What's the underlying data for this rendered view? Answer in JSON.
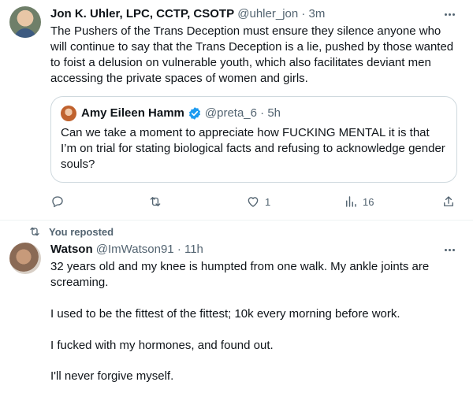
{
  "tweet1": {
    "author_name": "Jon K. Uhler, LPC, CCTP, CSOTP",
    "handle_time": "@uhler_jon · 3m",
    "text": "The Pushers of the Trans Deception must ensure they silence anyone who will continue to say that the Trans Deception is a lie, pushed by those wanted to foist a delusion on vulnerable youth, which also facilitates deviant men accessing the private spaces of women and girls.",
    "quote": {
      "author_name": "Amy Eileen Hamm",
      "handle_time": "@preta_6 · 5h",
      "text": "Can we take a moment to appreciate how FUCKING MENTAL it is that I’m on trial for stating biological facts and refusing to acknowledge gender souls?"
    },
    "actions": {
      "reply_count": "",
      "repost_count": "",
      "like_count": "1",
      "views_count": "16"
    }
  },
  "tweet2": {
    "repost_label": "You reposted",
    "author_name": "Watson",
    "handle_time": "@ImWatson91 · 11h",
    "paragraphs": [
      "32 years old and my knee is humpted from one walk. My ankle joints are screaming.",
      "I used to be the fittest of the fittest; 10k every morning before work.",
      "I fucked with my hormones, and found out.",
      "I'll never forgive myself."
    ]
  },
  "icons": [
    "reply-icon",
    "repost-icon",
    "like-icon",
    "views-icon",
    "share-icon",
    "more-icon",
    "verified-icon"
  ],
  "colors": {
    "text": "#0f1419",
    "muted": "#536471",
    "border": "#cfd9de",
    "verified": "#1d9bf0"
  }
}
